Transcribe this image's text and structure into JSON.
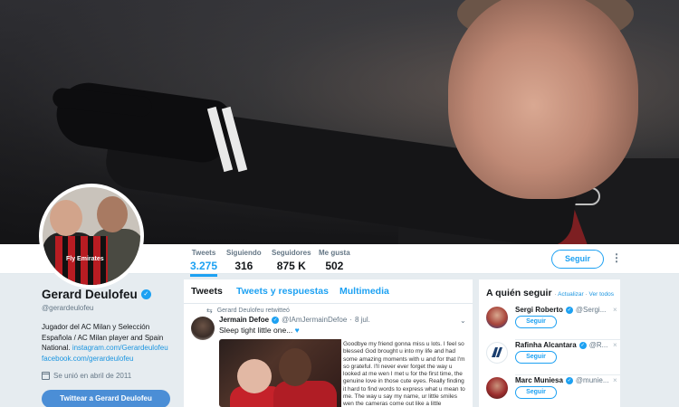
{
  "header_photo": {
    "alt": "header-photo"
  },
  "nav": {
    "stats": [
      {
        "label": "Tweets",
        "value": "3.275"
      },
      {
        "label": "Siguiendo",
        "value": "316"
      },
      {
        "label": "Seguidores",
        "value": "875 K"
      },
      {
        "label": "Me gusta",
        "value": "502"
      }
    ],
    "follow_label": "Seguir",
    "more": "⋮"
  },
  "avatar": {
    "shirt_text": "Fly Emirates"
  },
  "profile": {
    "name": "Gerard Deulofeu",
    "handle": "@gerardeulofeu",
    "bio_line1": "Jugador del AC Milan y Selección Española / AC Milan player and Spain National.",
    "bio_link1": "instagram.com/Gerardeulofeu",
    "website": "facebook.com/gerardeulofeu",
    "joined": "Se unió en abril de 2011",
    "tweet_to": "Twittear a Gerard Deulofeu"
  },
  "timeline": {
    "tabs": [
      "Tweets",
      "Tweets y respuestas",
      "Multimedia"
    ],
    "retweet_by": "Gerard Deulofeu retwitteó",
    "tweet": {
      "name": "Jermain Defoe",
      "handle": "@IAmJermainDefoe",
      "date": "8 jul.",
      "text": "Sleep tight little one...",
      "media_text": "Goodbye my friend gonna miss u lots. I feel so blessed God brought u into my life and had some amazing moments with u and for that I'm so grateful. I'll never ever forget the way u looked at me wen I met u for the first time, the genuine love in those cute eyes. Really finding it hard to find words to express what u mean to me. The way u say my name, ur little smiles wen the cameras come out like a little"
    }
  },
  "who_to_follow": {
    "title": "A quién seguir",
    "refresh": "Actualizar",
    "view_all": "Ver todos",
    "suggestions": [
      {
        "name": "Sergi Roberto",
        "handle": "@Sergi...",
        "button": "Seguir"
      },
      {
        "name": "Rafinha Alcantara",
        "handle": "@R...",
        "button": "Seguir"
      },
      {
        "name": "Marc Muniesa",
        "handle": "@munie...",
        "button": "Seguir"
      }
    ]
  },
  "colors": {
    "accent": "#1da1f2",
    "background": "#e6ecf0",
    "tweet_to_button": "#4b8ed6"
  }
}
